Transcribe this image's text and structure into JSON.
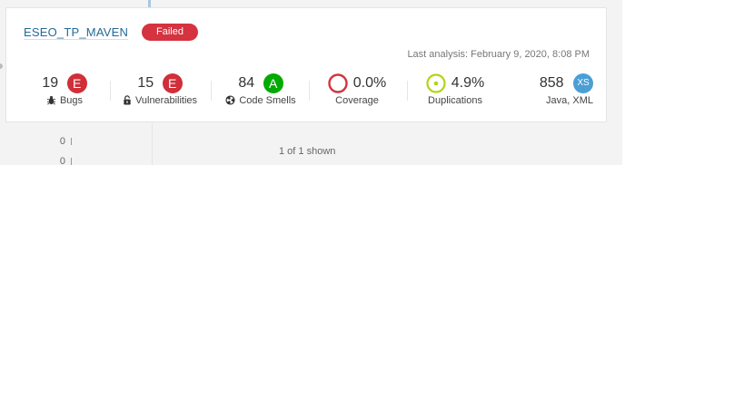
{
  "project": {
    "name": "ESEO_TP_MAVEN",
    "status": "Failed",
    "last_analysis": "Last analysis: February 9, 2020, 8:08 PM"
  },
  "measures": {
    "bugs": {
      "value": "19",
      "rating": "E",
      "label": "Bugs",
      "icon": "bug-icon"
    },
    "vulnerabilities": {
      "value": "15",
      "rating": "E",
      "label": "Vulnerabilities",
      "icon": "lock-icon"
    },
    "code_smells": {
      "value": "84",
      "rating": "A",
      "label": "Code Smells",
      "icon": "radiation-icon"
    },
    "coverage": {
      "value": "0.0%",
      "label": "Coverage",
      "icon": "coverage-ring-icon",
      "ring_color": "#d4333f"
    },
    "duplications": {
      "value": "4.9%",
      "label": "Duplications",
      "icon": "duplications-ring-icon",
      "ring_color": "#b0d513"
    },
    "size": {
      "value": "858",
      "badge": "XS",
      "label": "Java, XML"
    }
  },
  "left_list": {
    "rows": [
      "0",
      "0"
    ]
  },
  "footer": {
    "count_text": "1 of 1 shown"
  },
  "colors": {
    "failed": "#d4333f",
    "rating_e": "#d02f3a",
    "rating_a": "#00aa00",
    "size_badge": "#4b9fd5",
    "link": "#236a97"
  }
}
